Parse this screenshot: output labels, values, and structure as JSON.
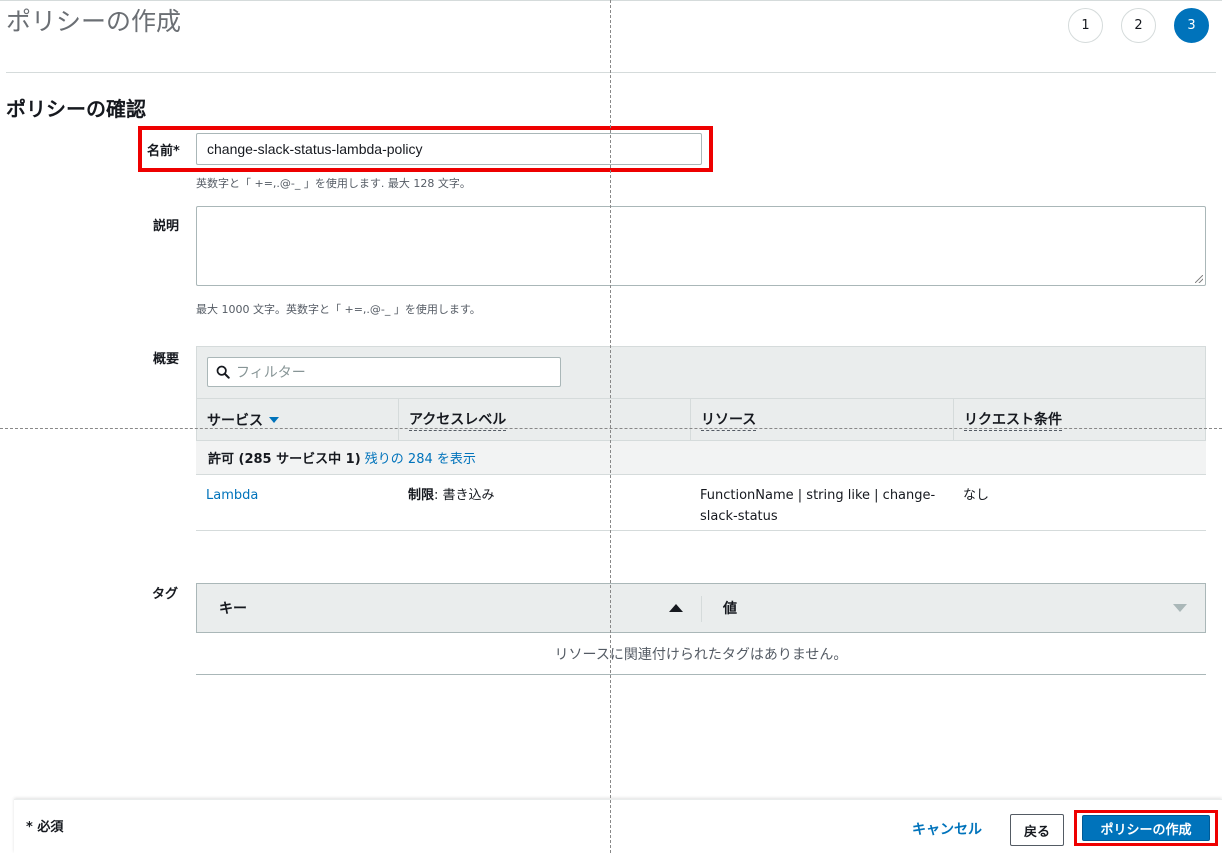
{
  "header": {
    "page_title": "ポリシーの作成",
    "steps": [
      "1",
      "2",
      "3"
    ],
    "active_step": "3"
  },
  "review": {
    "section_title": "ポリシーの確認",
    "name_label": "名前*",
    "name_value": "change-slack-status-lambda-policy",
    "name_hint": "英数字と「 +=,.@-_ 」を使用します. 最大 128 文字。",
    "description_label": "説明",
    "description_value": "",
    "description_hint": "最大 1000 文字。英数字と「 +=,.@-_ 」を使用します。"
  },
  "summary": {
    "label": "概要",
    "filter_placeholder": "フィルター",
    "columns": [
      "サービス",
      "アクセスレベル",
      "リソース",
      "リクエスト条件"
    ],
    "allow_prefix": "許可 (285 サービス中 1)",
    "allow_link": "残りの 284 を表示",
    "rows": [
      {
        "service": "Lambda",
        "access_level_bold": "制限",
        "access_level_rest": ": 書き込み",
        "resource": "FunctionName | string like | change-slack-status",
        "condition": "なし"
      }
    ]
  },
  "tags": {
    "label": "タグ",
    "key_header": "キー",
    "value_header": "値",
    "empty_message": "リソースに関連付けられたタグはありません。"
  },
  "footer": {
    "required_note": "* 必須",
    "cancel_label": "キャンセル",
    "back_label": "戻る",
    "create_label": "ポリシーの作成"
  },
  "colors": {
    "primary": "#0073bb",
    "highlight": "#ee0000",
    "header_bg": "#eaeded"
  }
}
